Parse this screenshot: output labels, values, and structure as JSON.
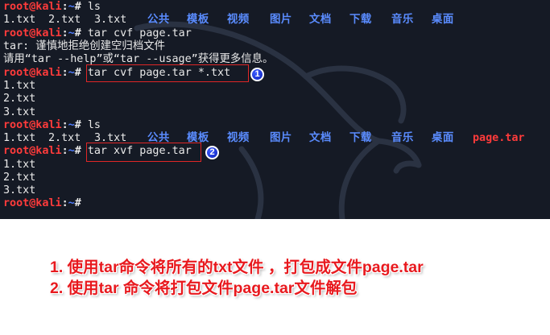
{
  "colors": {
    "terminal_bg": "#151a25",
    "prompt_user": "#ff3b3b",
    "prompt_path": "#4f7dff",
    "directory": "#5a8cff",
    "archive_file": "#ff3b3b",
    "annotation_box": "#e02626",
    "annotation_text": "#e8191e",
    "marker": "#1a33d6"
  },
  "prompt": {
    "user_host": "root@kali",
    "sep": ":",
    "path": "~",
    "symbol": "#"
  },
  "terminal": {
    "cmd_ls_1": "ls",
    "ls_1": [
      "1.txt",
      "2.txt",
      "3.txt",
      "公共",
      "模板",
      "视频",
      "图片",
      "文档",
      "下载",
      "音乐",
      "桌面"
    ],
    "cmd_tar_cvf_bad": "tar cvf page.tar",
    "error_line_1": "tar: 谨慎地拒绝创建空归档文件",
    "error_line_2": "请用“tar --help”或“tar --usage”获得更多信息。",
    "cmd_tar_cvf": "tar cvf page.tar *.txt",
    "cvf_output": [
      "1.txt",
      "2.txt",
      "3.txt"
    ],
    "cmd_ls_2": "ls",
    "ls_2": [
      "1.txt",
      "2.txt",
      "3.txt",
      "公共",
      "模板",
      "视频",
      "图片",
      "文档",
      "下载",
      "音乐",
      "桌面",
      "page.tar"
    ],
    "cmd_tar_xvf": "tar xvf page.tar",
    "xvf_output": [
      "1.txt",
      "2.txt",
      "3.txt"
    ]
  },
  "markers": {
    "first": "1",
    "second": "2"
  },
  "notes": {
    "line1": "1. 使用tar命令将所有的txt文件 ，打包成文件page.tar",
    "line2": "2. 使用tar 命令将打包文件page.tar文件解包"
  }
}
